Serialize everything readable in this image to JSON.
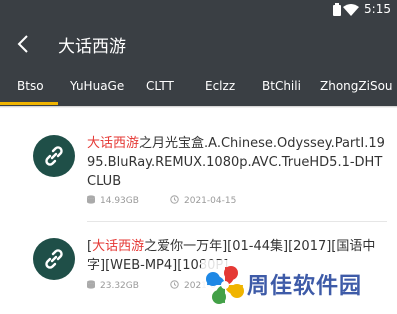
{
  "status_bar": {
    "time": "5:15",
    "icons": [
      "battery-icon",
      "wifi-icon"
    ]
  },
  "toolbar": {
    "back_icon": "back-arrow-icon",
    "title": "大话西游"
  },
  "tabs": [
    {
      "label": "Btso",
      "active": true
    },
    {
      "label": "YuHuaGe"
    },
    {
      "label": "CLTT"
    },
    {
      "label": "Eclzz"
    },
    {
      "label": "BtChili"
    },
    {
      "label": "ZhongZiSou"
    }
  ],
  "colors": {
    "header_bg": "#3a3f44",
    "accent": "#f0b400",
    "highlight": "#e53935",
    "avatar_bg": "#1f4f48",
    "watermark": "#3e5ba8"
  },
  "results": [
    {
      "keyword_prefix": "",
      "keyword": "大话西游",
      "title_rest": "之月光宝盒.A.Chinese.Odyssey.PartI.1995.BluRay.REMUX.1080p.AVC.TrueHD5.1-DHTCLUB",
      "size": "14.93GB",
      "date": "2021-04-15",
      "icon": "link-icon"
    },
    {
      "keyword_prefix": "[",
      "keyword": "大话西游",
      "title_rest": "之爱你一万年][01-44集][2017][国语中字][WEB-MP4][1080P]",
      "size": "23.32GB",
      "date": "2021-0",
      "icon": "link-icon"
    }
  ],
  "watermark": {
    "text": "周佳软件园",
    "logo": "pinwheel-logo"
  }
}
